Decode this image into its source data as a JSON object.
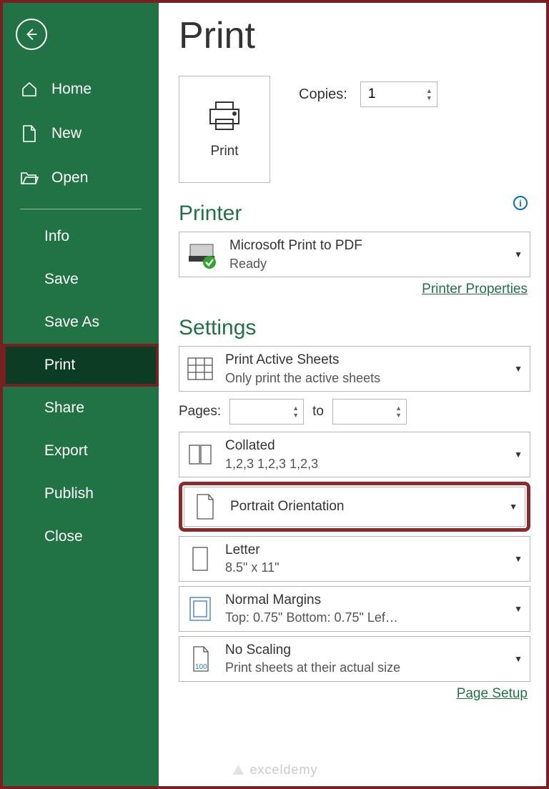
{
  "sidebar": {
    "home": "Home",
    "new": "New",
    "open": "Open",
    "info": "Info",
    "save": "Save",
    "saveas": "Save As",
    "print": "Print",
    "share": "Share",
    "export": "Export",
    "publish": "Publish",
    "close": "Close"
  },
  "page": {
    "title": "Print",
    "print_button": "Print",
    "copies_label": "Copies:",
    "copies_value": "1"
  },
  "printer": {
    "heading": "Printer",
    "name": "Microsoft Print to PDF",
    "status": "Ready",
    "properties_link": "Printer Properties"
  },
  "settings": {
    "heading": "Settings",
    "active_sheets": {
      "title": "Print Active Sheets",
      "sub": "Only print the active sheets"
    },
    "pages_label": "Pages:",
    "to_label": "to",
    "collated": {
      "title": "Collated",
      "sub": "1,2,3    1,2,3    1,2,3"
    },
    "orientation": {
      "title": "Portrait Orientation"
    },
    "paper": {
      "title": "Letter",
      "sub": "8.5\" x 11\""
    },
    "margins": {
      "title": "Normal Margins",
      "sub": "Top: 0.75\" Bottom: 0.75\" Lef…"
    },
    "scaling": {
      "title": "No Scaling",
      "sub": "Print sheets at their actual size"
    },
    "page_setup_link": "Page Setup"
  },
  "watermark": "exceldemy"
}
